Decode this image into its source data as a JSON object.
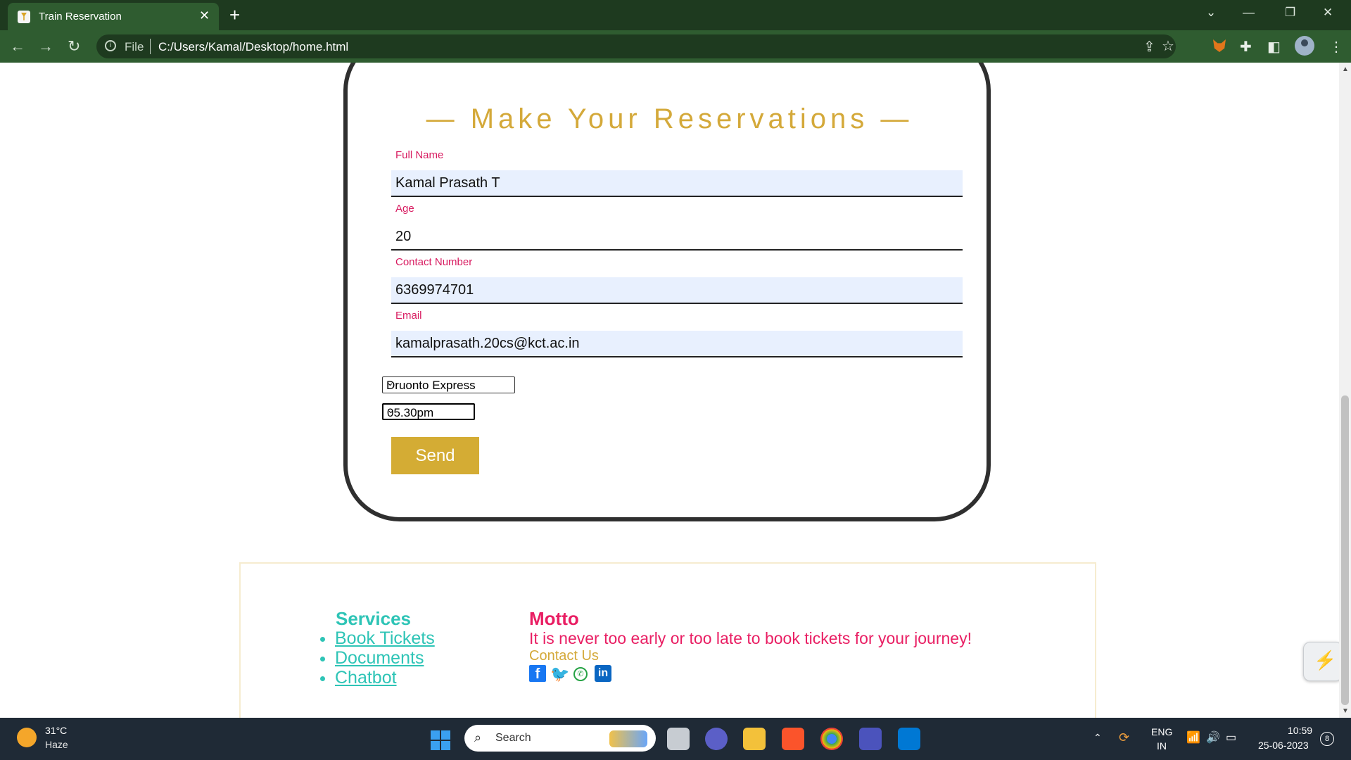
{
  "browser": {
    "tab_title": "Train Reservation",
    "new_tab": "+",
    "scheme_label": "File",
    "url": "C:/Users/Kamal/Desktop/home.html"
  },
  "form": {
    "heading": "— Make Your Reservations —",
    "full_name_label": "Full Name",
    "full_name_value": "Kamal Prasath T",
    "age_label": "Age",
    "age_value": "20",
    "contact_label": "Contact Number",
    "contact_value": "6369974701",
    "email_label": "Email",
    "email_value": "kamalprasath.20cs@kct.ac.in",
    "train_selected": "Druonto Express",
    "time_selected": "05.30pm",
    "send_label": "Send"
  },
  "footer": {
    "services_title": "Services",
    "services": [
      "Book Tickets",
      "Documents",
      "Chatbot"
    ],
    "motto_title": "Motto",
    "motto_text": "It is never too early or too late to book tickets for your journey!",
    "contact_label": "Contact Us",
    "social_icons": [
      "facebook-icon",
      "twitter-icon",
      "whatsapp-icon",
      "linkedin-icon"
    ]
  },
  "taskbar": {
    "temperature": "31°C",
    "weather": "Haze",
    "search_label": "Search",
    "language": "ENG",
    "region": "IN",
    "time": "10:59",
    "date": "25-06-2023",
    "notification_count": "8"
  },
  "colors": {
    "browser_frame": "#1e3a1f",
    "heading_gold": "#d4a93a",
    "label_pink": "#d81b60",
    "services_teal": "#2ec4b6",
    "send_button": "#d4ac34"
  }
}
